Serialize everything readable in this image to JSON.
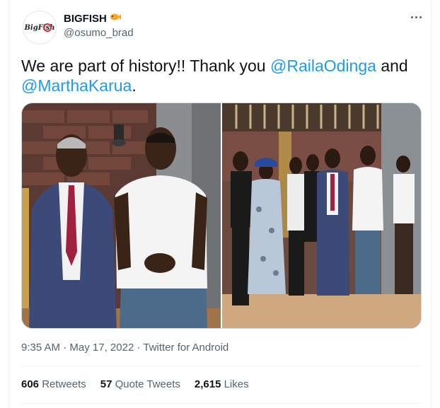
{
  "author": {
    "display_name": "BIGFISH",
    "handle": "@osumo_brad",
    "avatar_text": "BigFish",
    "name_emoji_icon": "fish-icon"
  },
  "tweet": {
    "text_prefix": "We are part of history!! Thank you ",
    "mention_1": "@RailaOdinga",
    "text_middle": " and",
    "mention_2": "@MarthaKarua",
    "text_suffix": "."
  },
  "meta": {
    "time": "9:35 AM",
    "separator": " · ",
    "date": "May 17, 2022",
    "source": "Twitter for Android"
  },
  "stats": {
    "retweets_count": "606",
    "retweets_label": "Retweets",
    "quotes_count": "57",
    "quotes_label": "Quote Tweets",
    "likes_count": "2,615",
    "likes_label": "Likes"
  },
  "colors": {
    "accent": "#1d9bf0",
    "text": "#0f1419",
    "muted": "#536471"
  }
}
